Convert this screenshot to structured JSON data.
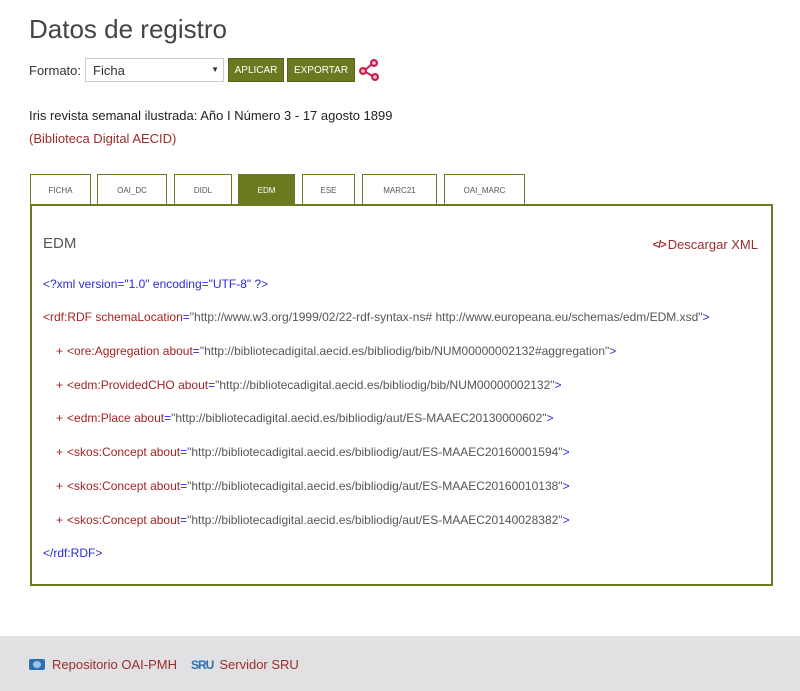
{
  "page_title": "Datos de registro",
  "format": {
    "label": "Formato:",
    "selected": "Ficha",
    "apply_label": "APLICAR",
    "export_label": "EXPORTAR"
  },
  "record": {
    "title": "Iris revista semanal ilustrada: Año I Número 3 - 17 agosto 1899",
    "source": "(Biblioteca Digital AECID)"
  },
  "tabs": [
    {
      "label": "FICHA"
    },
    {
      "label": "OAI_DC"
    },
    {
      "label": "DIDL"
    },
    {
      "label": "EDM",
      "active": true
    },
    {
      "label": "ESE"
    },
    {
      "label": "MARC21"
    },
    {
      "label": "OAI_MARC"
    }
  ],
  "panel": {
    "title": "EDM",
    "download_label": "Descargar XML",
    "xml_decl": "<?xml version=\"1.0\" encoding=\"UTF-8\" ?>",
    "root": {
      "open_tag": "<rdf:RDF",
      "attr": "schemaLocation",
      "value": "\"http://www.w3.org/1999/02/22-rdf-syntax-ns# http://www.europeana.eu/schemas/edm/EDM.xsd\"",
      "close": ">"
    },
    "children": [
      {
        "tag": "<ore:Aggregation",
        "attr": "about",
        "value": "\"http://bibliotecadigital.aecid.es/bibliodig/bib/NUM00000002132#aggregation\""
      },
      {
        "tag": "<edm:ProvidedCHO",
        "attr": "about",
        "value": "\"http://bibliotecadigital.aecid.es/bibliodig/bib/NUM00000002132\""
      },
      {
        "tag": "<edm:Place",
        "attr": "about",
        "value": "\"http://bibliotecadigital.aecid.es/bibliodig/aut/ES-MAAEC20130000602\""
      },
      {
        "tag": "<skos:Concept",
        "attr": "about",
        "value": "\"http://bibliotecadigital.aecid.es/bibliodig/aut/ES-MAAEC20160001594\""
      },
      {
        "tag": "<skos:Concept",
        "attr": "about",
        "value": "\"http://bibliotecadigital.aecid.es/bibliodig/aut/ES-MAAEC20160010138\""
      },
      {
        "tag": "<skos:Concept",
        "attr": "about",
        "value": "\"http://bibliotecadigital.aecid.es/bibliodig/aut/ES-MAAEC20140028382\""
      }
    ],
    "root_close": "</rdf:RDF>"
  },
  "footer": {
    "oai_label": "Repositorio OAI-PMH",
    "sru_label": "Servidor SRU",
    "sru_icon_text": "SRU"
  },
  "colors": {
    "accent": "#6b7a21",
    "link": "#9b2c2c"
  }
}
